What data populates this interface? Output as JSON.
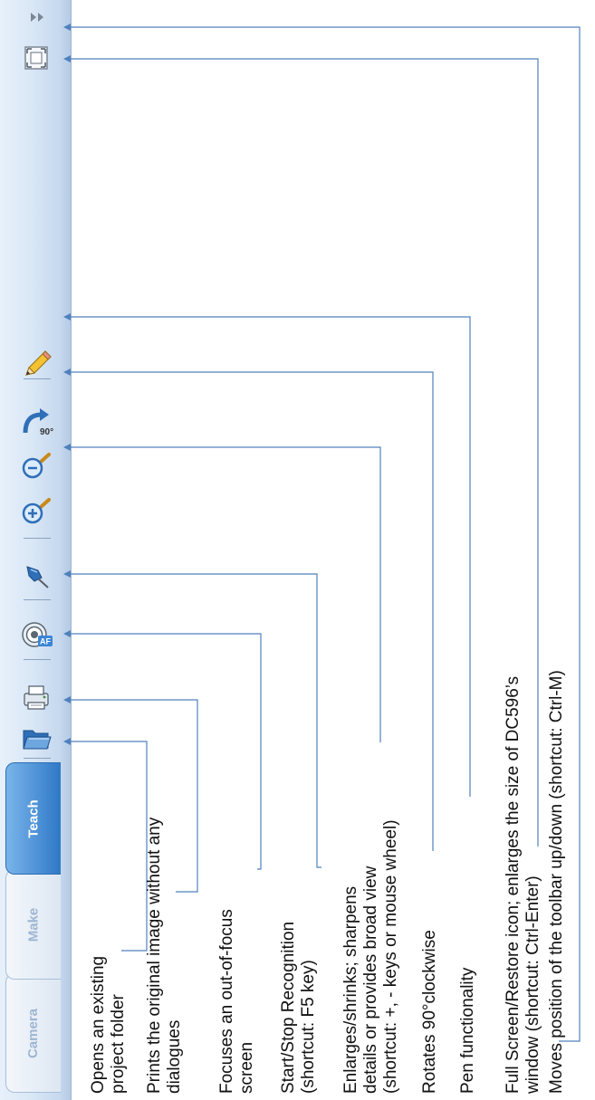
{
  "toolbar": {
    "tabs": [
      {
        "label": "Camera"
      },
      {
        "label": "Make"
      },
      {
        "label": "Teach"
      }
    ],
    "icons": {
      "open_folder": "open-folder-icon",
      "print": "printer-icon",
      "auto_focus": "auto-focus-icon",
      "recognition": "pin-icon",
      "zoom_in": "zoom-in-icon",
      "zoom_out": "zoom-out-icon",
      "rotate": "rotate-90-icon",
      "pen": "pen-icon",
      "fullscreen": "fullscreen-icon",
      "move_toolbar": "double-chevron-icon"
    },
    "colors": {
      "leader_line": "#4f81bd",
      "active_tab": "#2f78c7"
    }
  },
  "annotations": [
    {
      "key": "open_folder",
      "lines": [
        "Opens an existing",
        "project folder"
      ]
    },
    {
      "key": "print",
      "lines": [
        "Prints the original image without any",
        "dialogues"
      ]
    },
    {
      "key": "auto_focus",
      "lines": [
        "Focuses an out-of-focus",
        "screen"
      ]
    },
    {
      "key": "recognition",
      "lines": [
        "Start/Stop Recognition",
        "(shortcut:  F5 key)"
      ]
    },
    {
      "key": "zoom",
      "lines": [
        "Enlarges/shrinks; sharpens",
        "details or provides broad view",
        "(shortcut: +, - keys or mouse wheel)"
      ]
    },
    {
      "key": "rotate",
      "lines": [
        "Rotates 90°clockwise"
      ]
    },
    {
      "key": "pen",
      "lines": [
        "Pen functionality"
      ]
    },
    {
      "key": "fullscreen",
      "lines": [
        "Full Screen/Restore icon; enlarges the size of DC596’s",
        "window (shortcut: Ctrl-Enter)"
      ]
    },
    {
      "key": "move_toolbar",
      "lines": [
        "Moves position of the toolbar up/down (shortcut: Ctrl-M)"
      ]
    }
  ]
}
